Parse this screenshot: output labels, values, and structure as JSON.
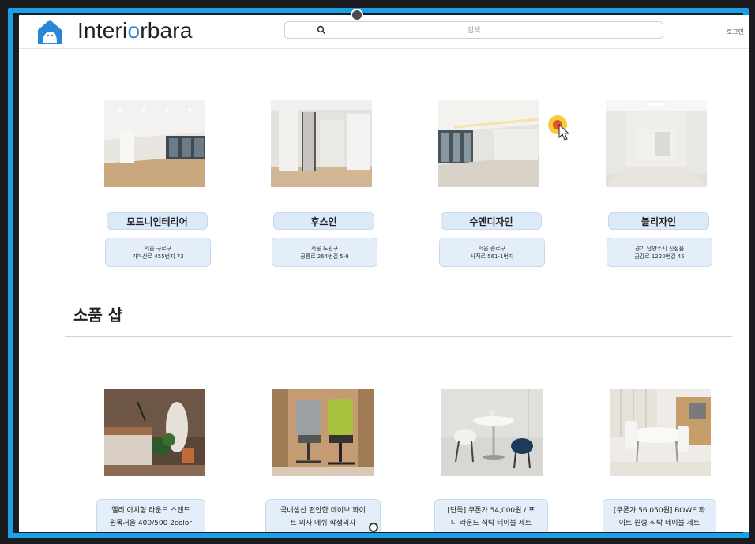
{
  "header": {
    "logo_prefix": "Interi",
    "logo_o": "o",
    "logo_suffix": "rbara",
    "search_placeholder": "검색",
    "login_label": "로그인"
  },
  "companies": [
    {
      "name": "모드니인테리어",
      "addr1": "서울 구로구",
      "addr2": "가마산로 455번지 73"
    },
    {
      "name": "후스인",
      "addr1": "서울 노원구",
      "addr2": "공릉로 264번길 5-9"
    },
    {
      "name": "수엔디자인",
      "addr1": "서울 중로구",
      "addr2": "사직로 561-1번지"
    },
    {
      "name": "블리자인",
      "addr1": "경기 남양주시 진접읍",
      "addr2": "금강로 1220번길 45"
    }
  ],
  "shop": {
    "title": "소품 샵",
    "products": [
      {
        "line1": "엘리 아치형 라운드 스탠드",
        "line2": "원목거울 400/500 2color"
      },
      {
        "line1": "국내생산 편안한 데이브 화이",
        "line2": "트 의자 메쉬 학생의자"
      },
      {
        "line1": "[단독] 쿠폰가 54,000원 / 포",
        "line2": "니 라운드 식탁 테이블 세트"
      },
      {
        "line1": "[쿠폰가 56,050원] BOWE 화",
        "line2": "이트 원형 식탁 테이블 세트"
      }
    ]
  },
  "colors": {
    "frame": "#1aa0e6",
    "pill": "#dbe9f8",
    "logo_accent": "#2c86d8"
  }
}
